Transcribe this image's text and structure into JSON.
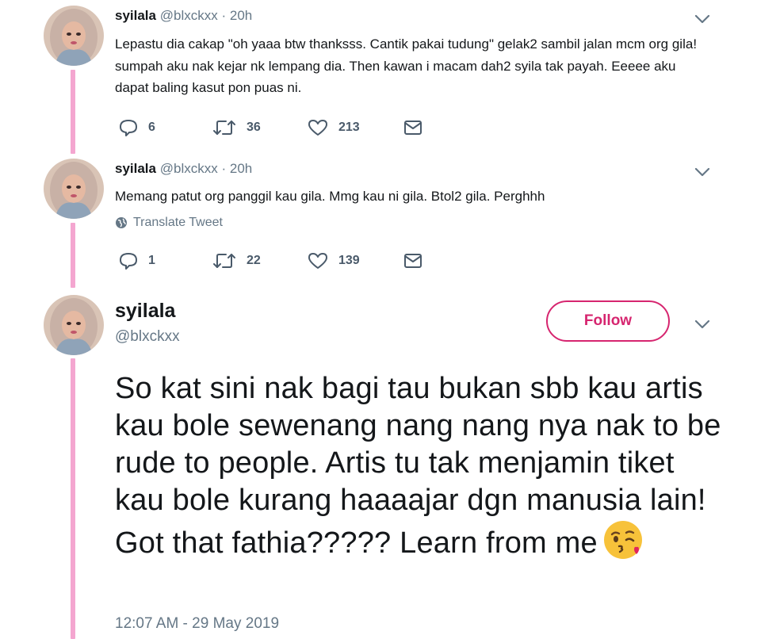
{
  "tweets": [
    {
      "name": "syilala",
      "handle": "@blxckxx",
      "time": "20h",
      "text": "Lepastu dia cakap \"oh yaaa btw thanksss. Cantik pakai tudung\" gelak2 sambil jalan mcm org gila! sumpah aku nak kejar nk lempang dia. Then kawan i macam dah2 syila tak payah. Eeeee aku dapat baling kasut pon puas ni.",
      "replies": "6",
      "retweets": "36",
      "likes": "213"
    },
    {
      "name": "syilala",
      "handle": "@blxckxx",
      "time": "20h",
      "text": "Memang patut org panggil kau gila. Mmg kau ni gila. Btol2 gila. Perghhh",
      "translate": "Translate Tweet",
      "replies": "1",
      "retweets": "22",
      "likes": "139"
    }
  ],
  "main_tweet": {
    "name": "syilala",
    "handle": "@blxckxx",
    "follow_label": "Follow",
    "text": "So kat sini nak bagi tau bukan sbb kau artis kau bole sewenang nang nang nya nak to be rude to people. Artis tu tak menjamin tiket kau bole kurang haaaajar dgn manusia lain! Got that fathia????? Learn from me",
    "emoji": "face-throwing-a-kiss",
    "timestamp": "12:07 AM - 29 May 2019"
  },
  "icons": {
    "reply": "reply-icon",
    "retweet": "retweet-icon",
    "like": "heart-icon",
    "dm": "envelope-icon",
    "chevron": "chevron-down-icon",
    "globe": "globe-icon"
  },
  "colors": {
    "thread_line": "#f4a6d0",
    "accent": "#d6256f",
    "text": "#14171a",
    "muted": "#657786"
  }
}
